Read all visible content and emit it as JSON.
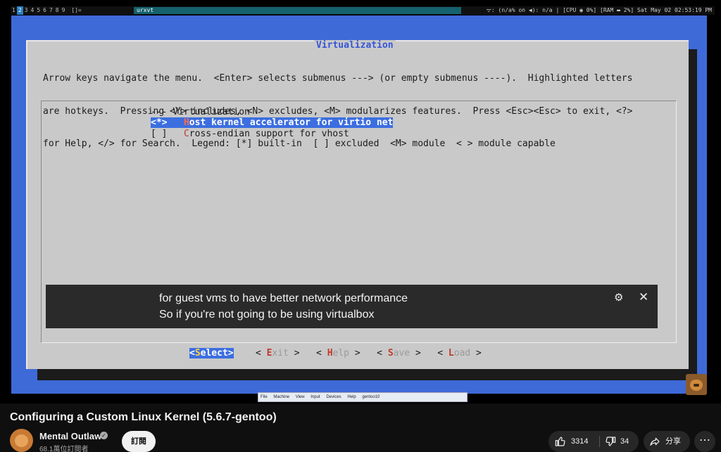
{
  "i3bar": {
    "workspaces": [
      "1",
      "2",
      "3",
      "4",
      "5",
      "6",
      "7",
      "8",
      "9"
    ],
    "active_workspace": "2",
    "layout_indicator": "[]=",
    "window_title": "urxvt",
    "status": "ᯤ: (n/a% on ◀): n/a | [CPU ◉ 0%] [RAM ▬ 2%] Sat May 02 02:53:19 PM"
  },
  "menuconfig": {
    "title": "Virtualization",
    "help_lines": [
      "Arrow keys navigate the menu.  <Enter> selects submenus ---> (or empty submenus ----).  Highlighted letters",
      "are hotkeys.  Pressing <Y> includes, <N> excludes, <M> modularizes features.  Press <Esc><Esc> to exit, <?>",
      "for Help, </> for Search.  Legend: [*] built-in  [ ] excluded  <M> module  < > module capable"
    ],
    "menu_header": "--- Virtualization",
    "items": [
      {
        "prefix": "<*>   ",
        "hotkey": "H",
        "rest": "ost kernel accelerator for virtio net",
        "selected": true
      },
      {
        "prefix": "[ ]   ",
        "hotkey": "C",
        "rest": "ross-endian support for vhost",
        "selected": false
      }
    ],
    "buttons": [
      {
        "open": "<",
        "hotkey": "S",
        "rest": "elect",
        "close": ">",
        "active": true
      },
      {
        "open": "< ",
        "hotkey": "E",
        "rest": "xit",
        "close": " >",
        "active": false
      },
      {
        "open": "< ",
        "hotkey": "H",
        "rest": "elp",
        "close": " >",
        "active": false
      },
      {
        "open": "< ",
        "hotkey": "S",
        "rest": "ave",
        "close": " >",
        "active": false
      },
      {
        "open": "< ",
        "hotkey": "L",
        "rest": "oad",
        "close": " >",
        "active": false
      }
    ]
  },
  "subtitles": {
    "line1": "for guest vms to have better network performance",
    "line2": "So if you're not going to be using virtualbox",
    "settings_icon": "gear-icon",
    "close_icon": "close-icon"
  },
  "vbox_menubar": {
    "items": [
      "File",
      "Machine",
      "View",
      "Input",
      "Devices",
      "Help"
    ],
    "vm_name": "gentoo10"
  },
  "video": {
    "title": "Configuring a Custom Linux Kernel (5.6.7-gentoo)",
    "channel_name": "Mental Outlaw",
    "subscribers": "68.1萬位訂閱者",
    "subscribe_label": "訂閱",
    "likes": "3314",
    "dislikes": "34",
    "share_label": "分享",
    "more_label": "⋯"
  },
  "colors": {
    "vm_background": "#3e6ad8",
    "dialog": "#c9c9c9",
    "highlight": "#3c6ee0",
    "hotkey": "#c0392b",
    "page_background": "#0f0f0f"
  }
}
